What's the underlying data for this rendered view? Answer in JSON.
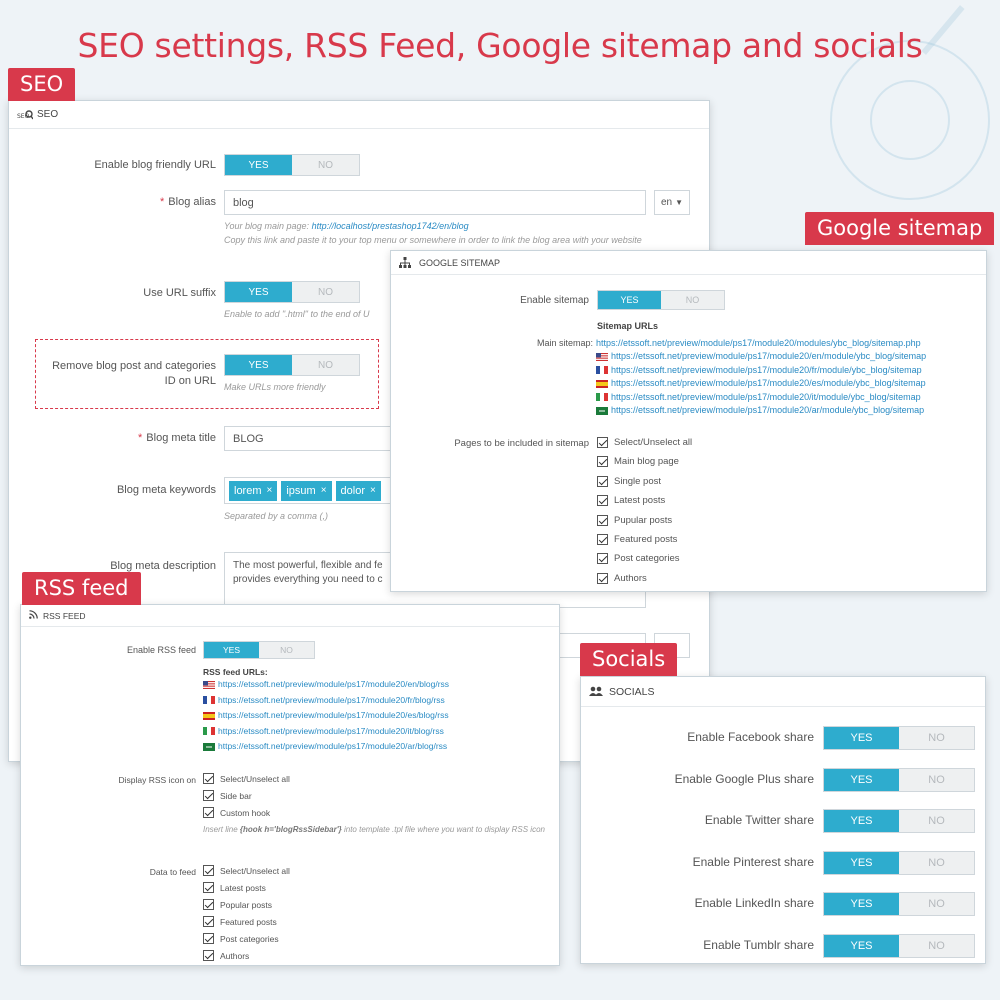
{
  "headline": "SEO settings, RSS Feed, Google sitemap and socials",
  "tags": {
    "seo": "SEO",
    "google_sitemap": "Google sitemap",
    "rss_feed": "RSS feed",
    "socials": "Socials"
  },
  "seo": {
    "panel_title": "SEO",
    "enable_friendly_url_label": "Enable blog friendly URL",
    "yes": "YES",
    "no": "NO",
    "blog_alias_label": "Blog alias",
    "blog_alias_value": "blog",
    "lang": "en",
    "main_page_prefix": "Your blog main page:",
    "main_page_url": "http://localhost/prestashop1742/en/blog",
    "copy_hint": "Copy this link and paste it to your top menu or somewhere in order to link the blog area with your website",
    "use_url_suffix_label": "Use URL suffix",
    "suffix_hint": "Enable to add \".html\" to the end of U",
    "remove_id_label_1": "Remove blog post and categories",
    "remove_id_label_2": "ID on URL",
    "remove_id_hint": "Make URLs more friendly",
    "meta_title_label": "Blog meta title",
    "meta_title_value": "BLOG",
    "meta_keywords_label": "Blog meta keywords",
    "keywords": [
      "lorem",
      "ipsum",
      "dolor"
    ],
    "keywords_hint": "Separated by a comma (,)",
    "meta_desc_label": "Blog meta description",
    "meta_desc_line1": "The most powerful, flexible and fe",
    "meta_desc_line2": "provides everything you need to c"
  },
  "sitemap": {
    "panel_title": "GOOGLE SITEMAP",
    "enable_label": "Enable sitemap",
    "yes": "YES",
    "no": "NO",
    "urls_title": "Sitemap URLs",
    "main_label": "Main sitemap:",
    "main_url": "https://etssoft.net/preview/module/ps17/module20/modules/ybc_blog/sitemap.php",
    "lang_urls": [
      {
        "flag": "us",
        "url": "https://etssoft.net/preview/module/ps17/module20/en/module/ybc_blog/sitemap"
      },
      {
        "flag": "fr",
        "url": "https://etssoft.net/preview/module/ps17/module20/fr/module/ybc_blog/sitemap"
      },
      {
        "flag": "es",
        "url": "https://etssoft.net/preview/module/ps17/module20/es/module/ybc_blog/sitemap"
      },
      {
        "flag": "it",
        "url": "https://etssoft.net/preview/module/ps17/module20/it/module/ybc_blog/sitemap"
      },
      {
        "flag": "ar",
        "url": "https://etssoft.net/preview/module/ps17/module20/ar/module/ybc_blog/sitemap"
      }
    ],
    "pages_label": "Pages to be included in sitemap",
    "pages": [
      "Select/Unselect all",
      "Main blog page",
      "Single post",
      "Latest posts",
      "Pupular posts",
      "Featured posts",
      "Post categories",
      "Authors"
    ]
  },
  "rss": {
    "panel_title": "RSS FEED",
    "enable_label": "Enable RSS feed",
    "yes": "YES",
    "no": "NO",
    "urls_title": "RSS feed URLs:",
    "lang_urls": [
      {
        "flag": "us",
        "url": "https://etssoft.net/preview/module/ps17/module20/en/blog/rss"
      },
      {
        "flag": "fr",
        "url": "https://etssoft.net/preview/module/ps17/module20/fr/blog/rss"
      },
      {
        "flag": "es",
        "url": "https://etssoft.net/preview/module/ps17/module20/es/blog/rss"
      },
      {
        "flag": "it",
        "url": "https://etssoft.net/preview/module/ps17/module20/it/blog/rss"
      },
      {
        "flag": "ar",
        "url": "https://etssoft.net/preview/module/ps17/module20/ar/blog/rss"
      }
    ],
    "display_label": "Display RSS icon on",
    "display_options": [
      "Select/Unselect all",
      "Side bar",
      "Custom hook"
    ],
    "hook_hint_prefix": "Insert line",
    "hook_hint_code": "{hook h='blogRssSidebar'}",
    "hook_hint_suffix": "into template .tpl file where you want to display RSS icon",
    "data_label": "Data to feed",
    "data_options": [
      "Select/Unselect all",
      "Latest posts",
      "Popular posts",
      "Featured posts",
      "Post categories",
      "Authors"
    ]
  },
  "socials": {
    "panel_title": "SOCIALS",
    "yes": "YES",
    "no": "NO",
    "items": [
      "Enable Facebook share",
      "Enable Google Plus share",
      "Enable Twitter share",
      "Enable Pinterest share",
      "Enable LinkedIn share",
      "Enable Tumblr share"
    ]
  }
}
